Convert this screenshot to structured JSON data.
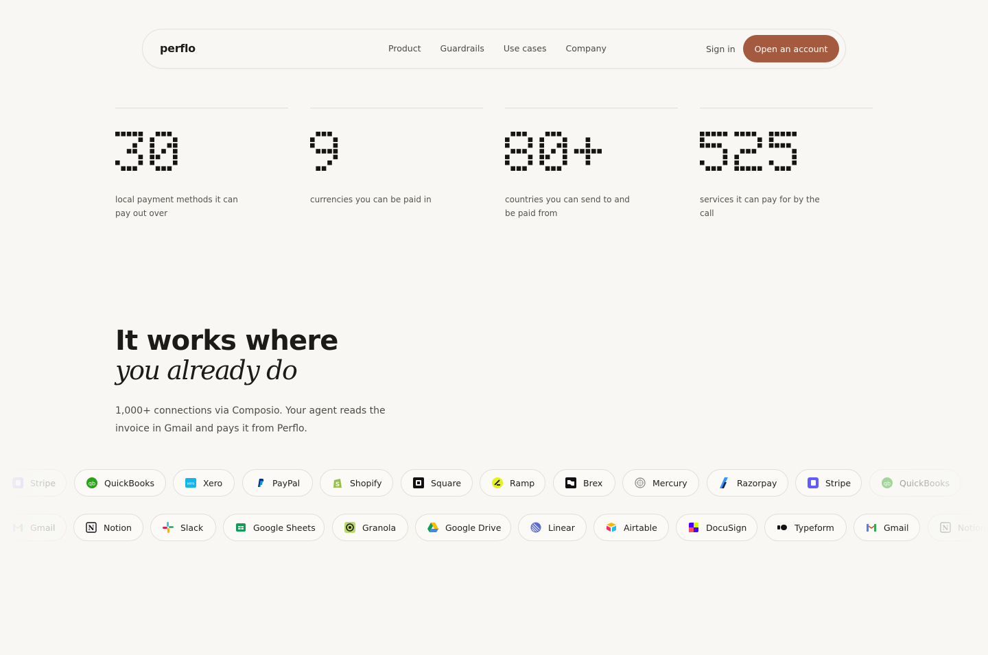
{
  "nav": {
    "logo": "perflo",
    "links": [
      "Product",
      "Guardrails",
      "Use cases",
      "Company"
    ],
    "signin": "Sign in",
    "cta": "Open an account",
    "cta_color": "#a35a3f"
  },
  "stats": [
    {
      "value": "30",
      "desc": "local payment methods it can pay out over"
    },
    {
      "value": "9",
      "desc": "currencies you can be paid in"
    },
    {
      "value": "80+",
      "desc": "countries you can send to and be paid from"
    },
    {
      "value": "525",
      "desc": "services it can pay for by the call"
    }
  ],
  "section": {
    "title_line1": "It works where",
    "title_line2": "you already do",
    "lede": "1,000+ connections via Composio. Your agent reads the invoice in Gmail and pays it from Perflo."
  },
  "integrations_row1": [
    {
      "label": "Stripe",
      "icon": "stripe-icon"
    },
    {
      "label": "QuickBooks",
      "icon": "quickbooks-icon"
    },
    {
      "label": "Xero",
      "icon": "xero-icon"
    },
    {
      "label": "PayPal",
      "icon": "paypal-icon"
    },
    {
      "label": "Shopify",
      "icon": "shopify-icon"
    },
    {
      "label": "Square",
      "icon": "square-icon"
    },
    {
      "label": "Ramp",
      "icon": "ramp-icon"
    },
    {
      "label": "Brex",
      "icon": "brex-icon"
    },
    {
      "label": "Mercury",
      "icon": "mercury-icon"
    },
    {
      "label": "Razorpay",
      "icon": "razorpay-icon"
    },
    {
      "label": "Stripe",
      "icon": "stripe-icon"
    },
    {
      "label": "QuickBooks",
      "icon": "quickbooks-icon"
    }
  ],
  "integrations_row2": [
    {
      "label": "Gmail",
      "icon": "gmail-icon"
    },
    {
      "label": "Notion",
      "icon": "notion-icon"
    },
    {
      "label": "Slack",
      "icon": "slack-icon"
    },
    {
      "label": "Google Sheets",
      "icon": "google-sheets-icon"
    },
    {
      "label": "Granola",
      "icon": "granola-icon"
    },
    {
      "label": "Google Drive",
      "icon": "google-drive-icon"
    },
    {
      "label": "Linear",
      "icon": "linear-icon"
    },
    {
      "label": "Airtable",
      "icon": "airtable-icon"
    },
    {
      "label": "DocuSign",
      "icon": "docusign-icon"
    },
    {
      "label": "Typeform",
      "icon": "typeform-icon"
    },
    {
      "label": "Gmail",
      "icon": "gmail-icon"
    },
    {
      "label": "Notion",
      "icon": "notion-icon"
    }
  ]
}
